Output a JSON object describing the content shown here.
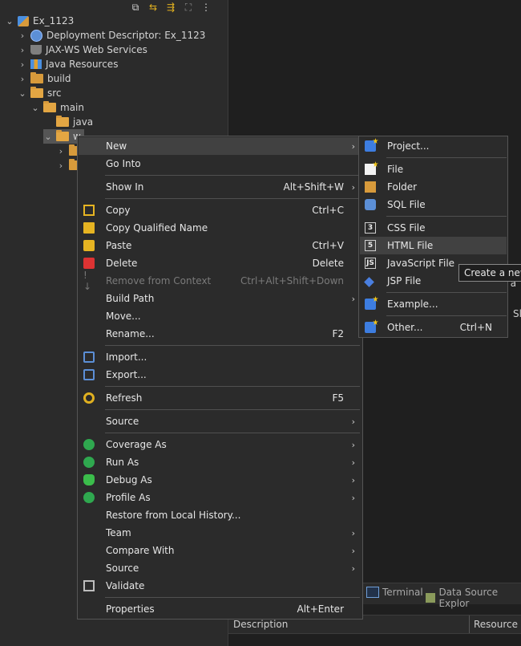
{
  "tree": {
    "items": [
      {
        "label": "Ex_1123",
        "level": 0,
        "expanded": true,
        "icon": "project-icon"
      },
      {
        "label": "Deployment Descriptor: Ex_1123",
        "level": 1,
        "expanded": false,
        "icon": "deployment-descriptor-icon"
      },
      {
        "label": "JAX-WS Web Services",
        "level": 1,
        "expanded": false,
        "icon": "web-services-icon"
      },
      {
        "label": "Java Resources",
        "level": 1,
        "expanded": false,
        "icon": "java-resources-icon"
      },
      {
        "label": "build",
        "level": 1,
        "expanded": false,
        "icon": "folder-icon"
      },
      {
        "label": "src",
        "level": 1,
        "expanded": true,
        "icon": "folder-open-icon"
      },
      {
        "label": "main",
        "level": 2,
        "expanded": true,
        "icon": "folder-open-icon"
      },
      {
        "label": "java",
        "level": 3,
        "expanded": null,
        "icon": "folder-icon"
      },
      {
        "label": "w",
        "level": 2,
        "expanded": true,
        "icon": "folder-open-icon",
        "selected": true
      }
    ]
  },
  "context_menu": {
    "items": [
      {
        "label": "New",
        "shortcut": "",
        "submenu": true,
        "icon": ""
      },
      {
        "label": "Go Into",
        "shortcut": "",
        "submenu": false,
        "icon": ""
      },
      {
        "label": "Show In",
        "shortcut": "Alt+Shift+W",
        "submenu": true,
        "icon": ""
      },
      {
        "label": "Copy",
        "shortcut": "Ctrl+C",
        "submenu": false,
        "icon": "copy-icon"
      },
      {
        "label": "Copy Qualified Name",
        "shortcut": "",
        "submenu": false,
        "icon": "copy-qualified-name-icon"
      },
      {
        "label": "Paste",
        "shortcut": "Ctrl+V",
        "submenu": false,
        "icon": "paste-icon"
      },
      {
        "label": "Delete",
        "shortcut": "Delete",
        "submenu": false,
        "icon": "delete-icon"
      },
      {
        "label": "Remove from Context",
        "shortcut": "Ctrl+Alt+Shift+Down",
        "submenu": false,
        "icon": "remove-context-icon",
        "disabled": true
      },
      {
        "label": "Build Path",
        "shortcut": "",
        "submenu": true,
        "icon": ""
      },
      {
        "label": "Move...",
        "shortcut": "",
        "submenu": false,
        "icon": ""
      },
      {
        "label": "Rename...",
        "shortcut": "F2",
        "submenu": false,
        "icon": ""
      },
      {
        "label": "Import...",
        "shortcut": "",
        "submenu": false,
        "icon": "import-icon"
      },
      {
        "label": "Export...",
        "shortcut": "",
        "submenu": false,
        "icon": "export-icon"
      },
      {
        "label": "Refresh",
        "shortcut": "F5",
        "submenu": false,
        "icon": "refresh-icon"
      },
      {
        "label": "Source",
        "shortcut": "",
        "submenu": true,
        "icon": ""
      },
      {
        "label": "Coverage As",
        "shortcut": "",
        "submenu": true,
        "icon": "coverage-icon"
      },
      {
        "label": "Run As",
        "shortcut": "",
        "submenu": true,
        "icon": "run-icon"
      },
      {
        "label": "Debug As",
        "shortcut": "",
        "submenu": true,
        "icon": "debug-icon"
      },
      {
        "label": "Profile As",
        "shortcut": "",
        "submenu": true,
        "icon": "profile-icon"
      },
      {
        "label": "Restore from Local History...",
        "shortcut": "",
        "submenu": false,
        "icon": ""
      },
      {
        "label": "Team",
        "shortcut": "",
        "submenu": true,
        "icon": ""
      },
      {
        "label": "Compare With",
        "shortcut": "",
        "submenu": true,
        "icon": ""
      },
      {
        "label": "Source",
        "shortcut": "",
        "submenu": true,
        "icon": ""
      },
      {
        "label": "Validate",
        "shortcut": "",
        "submenu": false,
        "icon": "validate-icon"
      },
      {
        "label": "Properties",
        "shortcut": "Alt+Enter",
        "submenu": false,
        "icon": ""
      }
    ]
  },
  "submenu_new": {
    "items": [
      {
        "label": "Project...",
        "shortcut": "",
        "icon": "new-project-icon"
      },
      {
        "label": "File",
        "shortcut": "",
        "icon": "new-file-icon"
      },
      {
        "label": "Folder",
        "shortcut": "",
        "icon": "new-folder-icon"
      },
      {
        "label": "SQL File",
        "shortcut": "",
        "icon": "sql-file-icon"
      },
      {
        "label": "CSS File",
        "shortcut": "",
        "icon": "css-file-icon"
      },
      {
        "label": "HTML File",
        "shortcut": "",
        "icon": "html-file-icon"
      },
      {
        "label": "JavaScript File",
        "shortcut": "",
        "icon": "javascript-file-icon"
      },
      {
        "label": "JSP File",
        "shortcut": "",
        "icon": "jsp-file-icon"
      },
      {
        "label": "Example...",
        "shortcut": "",
        "icon": "example-icon"
      },
      {
        "label": "Other...",
        "shortcut": "Ctrl+N",
        "icon": "other-icon"
      }
    ]
  },
  "tooltip": {
    "text": "Create a new"
  },
  "editor_clipped": {
    "text1": "en a",
    "text2": "Sl"
  },
  "bottom_tabs": [
    {
      "label": "Terminal",
      "icon": "terminal-icon"
    },
    {
      "label": "Data Source Explor",
      "icon": "data-source-icon"
    }
  ],
  "problems_table": {
    "columns": [
      "Description",
      "Resource"
    ]
  }
}
